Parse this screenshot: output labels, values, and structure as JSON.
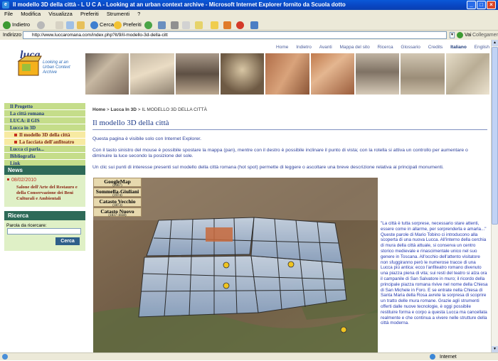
{
  "browser": {
    "title": "Il modello 3D della città - L U C A - Looking at an urban context archive - Microsoft Internet Explorer fornito da Scuola dotto",
    "menu": [
      "File",
      "Modifica",
      "Visualizza",
      "Preferiti",
      "Strumenti",
      "?"
    ],
    "toolbar": {
      "back": "Indietro",
      "search": "Cerca",
      "favorites": "Preferiti"
    },
    "address_label": "Indirizzo",
    "url": "http://www.luccaromana.com/index.php?it/9/il-modello-3d-della-citt",
    "go": "Vai",
    "links": "Collegamenti",
    "status": "Internet"
  },
  "page": {
    "logo": {
      "name": "luca",
      "tagline": "Looking at an Urban Context Archive"
    },
    "toplinks": [
      "Home",
      "Indietro",
      "Avanti",
      "Mappa del sito",
      "Ricerca",
      "Glossario",
      "Credits",
      "Italiano",
      "English"
    ],
    "nav": [
      {
        "label": "Il Progetto",
        "type": "item"
      },
      {
        "label": "La città romana",
        "type": "item"
      },
      {
        "label": "LUCA: il GIS",
        "type": "item"
      },
      {
        "label": "Lucca in 3D",
        "type": "item"
      },
      {
        "label": "Il modello 3D della città",
        "type": "sub"
      },
      {
        "label": "La facciata dell'anfiteatro",
        "type": "sub"
      },
      {
        "label": "Lucca ci parla...",
        "type": "item"
      },
      {
        "label": "Bibliografia",
        "type": "item"
      },
      {
        "label": "Link",
        "type": "item"
      }
    ],
    "news": {
      "heading": "News",
      "date": "08/02/2010",
      "text": "Salone dell'Arte del Restauro e della Conservazione dei Beni Culturali e Ambientali"
    },
    "search": {
      "heading": "Ricerca",
      "label": "Parola da ricercare:",
      "button": "Cerca"
    },
    "breadcrumb": {
      "home": "Home",
      "sep1": " > ",
      "section": "Lucca In 3D",
      "sep2": " > ",
      "current": "IL MODELLO 3D DELLA CITTÀ"
    },
    "title": "Il modello 3D della città",
    "para1": "Questa pagina è visibile solo con Internet Explorer.",
    "para2": "Con il tasto sinistro del mouse è possibile spostare la mappa (pan), mentre con il destro è possibile inclinare il punto di vista; con la rotella si attiva un controllo per aumentare o diminuire la luce secondo la posizione del sole.",
    "para3": "Un clic sui punti di interesse presenti sul modello della città romana (hot spot) permette di leggere o ascoltare una breve descrizione relativa ai principali monumenti.",
    "map_buttons": [
      {
        "label": "GoogleMap",
        "year": "(2007)"
      },
      {
        "label": "Sommella-Giuliani",
        "year": "(1974)"
      },
      {
        "label": "Catasto Vecchio",
        "year": "(1873)"
      },
      {
        "label": "Catasto Nuovo",
        "year": "(1837-1838)"
      }
    ],
    "side_text": "\"La città è tutta sorprese, necessario stare attenti, essere come in allarme, per sorprenderla e amarla...\" Queste parole di Mario Tobino ci introducono alla scoperta di una nuova Lucca. All'interno della cerchia di mura della città attuale, si conserva un centro storico medievale e rinascimentale unico nel suo genere in Toscana. All'occhio dell'attento visitatore non sfuggiranno però le numerose tracce di una Lucca più antica: ecco l'anfiteatro romano divenuto una piazza piena di vita; sui resti del teatro si alza ora il campanile di San Salvatore in muro; il ricordo della principale piazza romana rivive nel nome della Chiesa di San Michele in Foro. E se entrate nella Chiesa di Santa Maria della Rosa avrete la sorpresa di scoprire un tratto delle mura romane. Grazie agli strumenti offerti dalle nuove tecnologie, è oggi possibile restituire forma e corpo a questa Lucca ma cancellata realmente e che continua a vivere nelle strutture della città moderna."
  },
  "colors": {
    "accent": "#2c3f9a",
    "nav_bg": "#c5dd8a",
    "side_head": "#2e6a58",
    "title_blue": "#1f3c8a"
  }
}
